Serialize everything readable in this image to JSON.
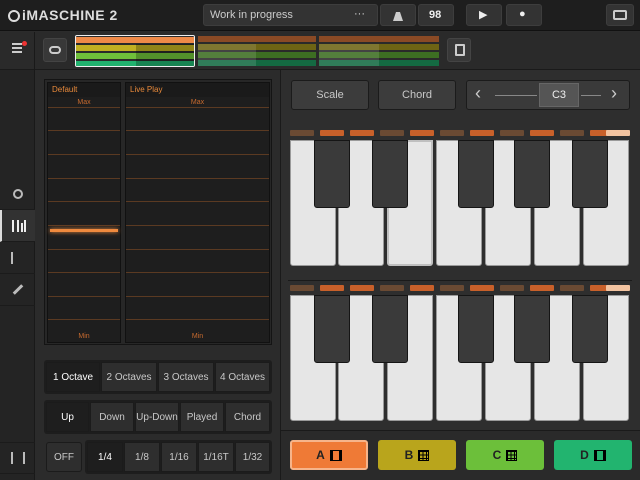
{
  "app": {
    "logo": "iMASCHINE 2"
  },
  "topbar": {
    "project_name": "Work in progress",
    "more_label": "···",
    "tempo": "98",
    "play_label": "▶",
    "record_label": "●"
  },
  "keyboard_controls": {
    "scale_label": "Scale",
    "chord_label": "Chord",
    "root_note": "C3",
    "prev_label": "‹",
    "next_label": "›"
  },
  "strips": [
    {
      "name": "Default",
      "max_label": "Max",
      "min_label": "Min",
      "level": 0.45
    },
    {
      "name": "Live Play",
      "max_label": "Max",
      "min_label": "Min"
    }
  ],
  "octaves": {
    "options": [
      "1 Octave",
      "2 Octaves",
      "3 Octaves",
      "4 Octaves"
    ],
    "selected": "1 Octave"
  },
  "arp_direction": {
    "options": [
      "Up",
      "Down",
      "Up-Down",
      "Played",
      "Chord"
    ],
    "selected": "Up"
  },
  "arp_rate": {
    "off_label": "OFF",
    "options": [
      "1/4",
      "1/8",
      "1/16",
      "1/16T",
      "1/32"
    ],
    "selected": "1/4"
  },
  "pad_groups": [
    {
      "label": "A",
      "color": "#ef7a36",
      "icon": "keyboard-icon"
    },
    {
      "label": "B",
      "color": "#b9a51c",
      "icon": "grid-icon"
    },
    {
      "label": "C",
      "color": "#6cbf3a",
      "icon": "grid-icon"
    },
    {
      "label": "D",
      "color": "#22b46f",
      "icon": "keyboard-icon"
    }
  ],
  "colors": {
    "accent": "#e8893a",
    "key_indicator_active": "#c8602a",
    "key_indicator_inactive": "#6a4a33",
    "key_indicator_root": "#f2c3a0"
  }
}
